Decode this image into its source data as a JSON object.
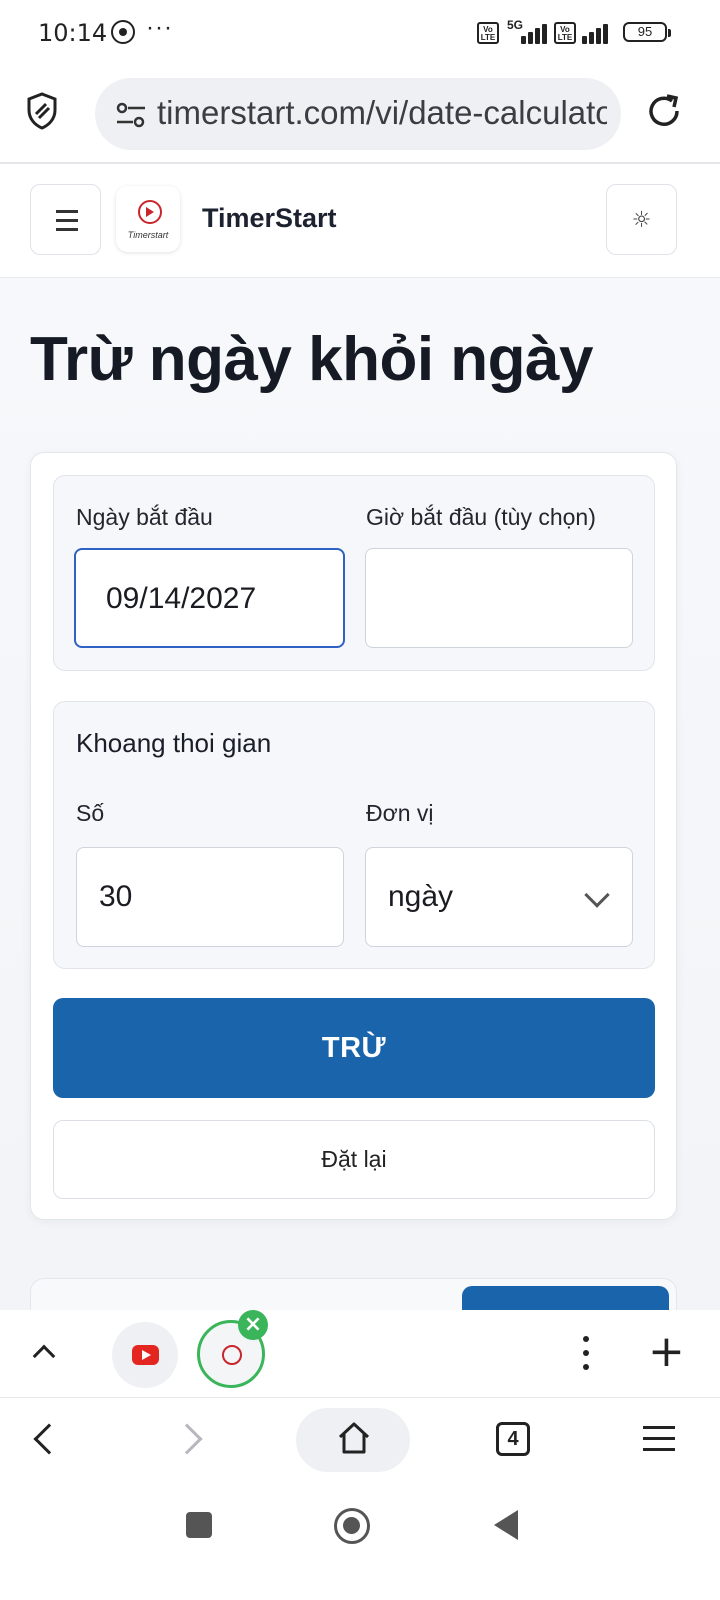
{
  "status_bar": {
    "time": "10:14",
    "dots": "···",
    "volte": "Vo LTE",
    "network": "5G",
    "battery": "95"
  },
  "browser": {
    "url": "timerstart.com/vi/date-calculator",
    "tab_count": "4"
  },
  "site": {
    "brand": "TimerStart",
    "logo_text": "Timerstart",
    "theme_icon": "☼"
  },
  "page": {
    "title": "Trừ ngày khỏi ngày",
    "start_date_label": "Ngày bắt đầu",
    "start_date_value": "09/14/2027",
    "start_time_label": "Giờ bắt đầu (tùy chọn)",
    "start_time_value": "",
    "interval_title": "Khoang thoi gian",
    "number_label": "Số",
    "number_value": "30",
    "unit_label": "Đơn vị",
    "unit_value": "ngày",
    "subtract_button": "TRỪ",
    "reset_button": "Đặt lại"
  },
  "tab_strip": {
    "close_icon": "×",
    "plus": "+"
  },
  "colors": {
    "primary": "#1a64ab",
    "focus": "#2e63c3",
    "active_tab": "#3ab55a",
    "brand_red": "#c8262c"
  }
}
